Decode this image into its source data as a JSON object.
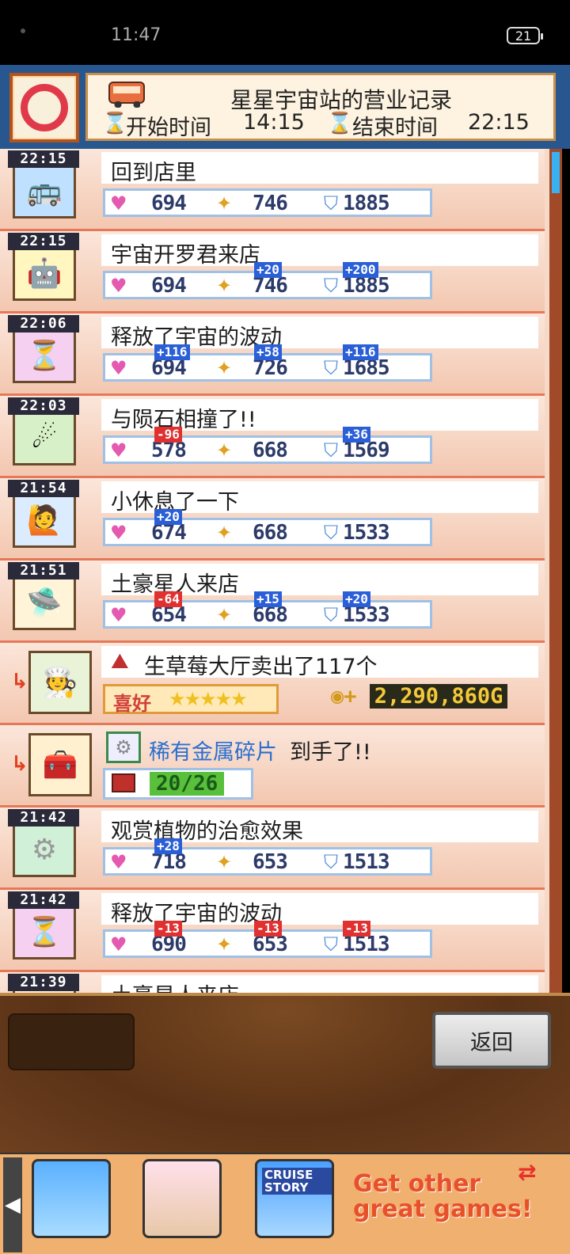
{
  "statusbar": {
    "time": "11:47",
    "battery": "21"
  },
  "header": {
    "title": "星星宇宙站的营业记录",
    "start_label": "开始时间",
    "start_time": "14:15",
    "end_label": "结束时间",
    "end_time": "22:15"
  },
  "entries": [
    {
      "time": "22:15",
      "text": "回到店里",
      "heart": "694",
      "star": "746",
      "shield": "1885",
      "d_heart": "",
      "d_star": "",
      "d_shield": ""
    },
    {
      "time": "22:15",
      "text": "宇宙开罗君来店",
      "heart": "694",
      "star": "746",
      "shield": "1885",
      "d_heart": "",
      "d_star": "+20",
      "d_shield": "+200"
    },
    {
      "time": "22:06",
      "text": "释放了宇宙的波动",
      "heart": "694",
      "star": "726",
      "shield": "1685",
      "d_heart": "+116",
      "d_star": "+58",
      "d_shield": "+116"
    },
    {
      "time": "22:03",
      "text": "与陨石相撞了!!",
      "heart": "578",
      "star": "668",
      "shield": "1569",
      "d_heart": "-96",
      "d_star": "",
      "d_shield": "+36"
    },
    {
      "time": "21:54",
      "text": "小休息了一下",
      "heart": "674",
      "star": "668",
      "shield": "1533",
      "d_heart": "+20",
      "d_star": "",
      "d_shield": ""
    },
    {
      "time": "21:51",
      "text": "土豪星人来店",
      "heart": "654",
      "star": "668",
      "shield": "1533",
      "d_heart": "-64",
      "d_star": "+15",
      "d_shield": "+20"
    }
  ],
  "sale": {
    "text": "生草莓大厅卖出了117个",
    "pref_label": "喜好",
    "stars": "★★★★★",
    "money": "2,290,860G"
  },
  "item": {
    "name": "稀有金属碎片",
    "suffix": "到手了!!",
    "count": "20/26"
  },
  "entries2": [
    {
      "time": "21:42",
      "text": "观赏植物的治愈效果",
      "heart": "718",
      "star": "653",
      "shield": "1513",
      "d_heart": "+28",
      "d_star": "",
      "d_shield": ""
    },
    {
      "time": "21:42",
      "text": "释放了宇宙的波动",
      "heart": "690",
      "star": "653",
      "shield": "1513",
      "d_heart": "-13",
      "d_star": "-13",
      "d_shield": "-13"
    },
    {
      "time": "21:39",
      "text": "土豪星人来店"
    }
  ],
  "buttons": {
    "back": "返回"
  },
  "ad": {
    "line1": "Get other",
    "line2": "great games!",
    "game3_label": "CRUISE STORY"
  },
  "colors": {
    "header_bg": "#28568f",
    "row_border": "#e6785a",
    "delta_up": "#2a5fd8",
    "delta_down": "#e03030"
  }
}
